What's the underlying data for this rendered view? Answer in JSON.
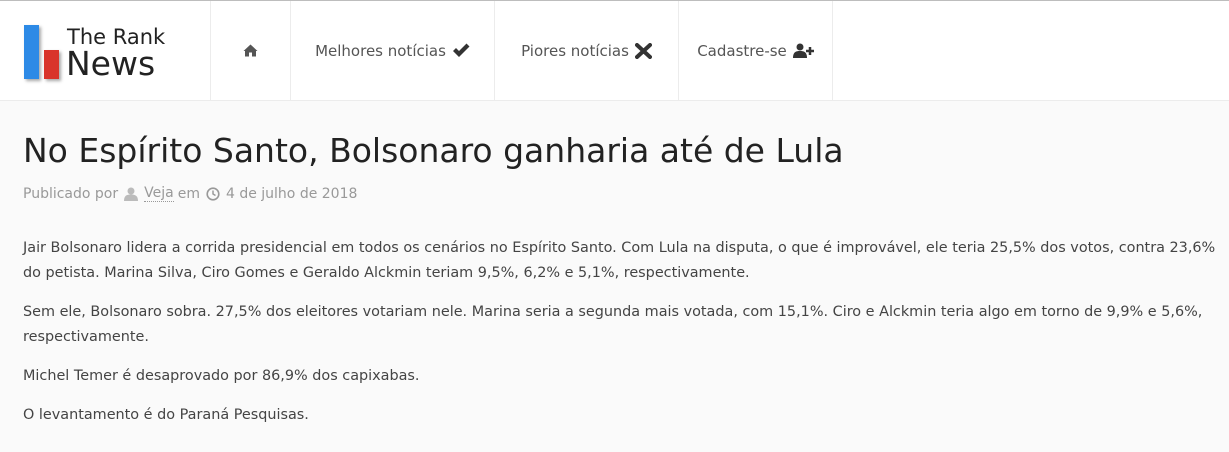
{
  "brand": {
    "line1": "The Rank",
    "line2": "News",
    "blue": "#2d8ae6",
    "red": "#d9342b"
  },
  "nav": {
    "home_icon": "home-icon",
    "best_label": "Melhores notícias",
    "best_icon": "check-icon",
    "worst_label": "Piores notícias",
    "worst_icon": "x-icon",
    "signup_label": "Cadastre-se",
    "signup_icon": "user-plus-icon"
  },
  "article": {
    "title": "No Espírito Santo, Bolsonaro ganharia até de Lula",
    "meta": {
      "published_by": "Publicado por",
      "author": "Veja",
      "in": "em",
      "date": "4 de julho de 2018"
    },
    "paragraphs": [
      "Jair Bolsonaro lidera a corrida presidencial em todos os cenários no Espírito Santo. Com Lula na disputa, o que é improvável, ele teria 25,5% dos votos, contra 23,6% do petista. Marina Silva, Ciro Gomes e Geraldo Alckmin teriam 9,5%, 6,2% e 5,1%, respectivamente.",
      "Sem ele, Bolsonaro sobra. 27,5% dos eleitores votariam nele. Marina seria a segunda mais votada, com 15,1%. Ciro e Alckmin teria algo em torno de 9,9% e 5,6%, respectivamente.",
      "Michel Temer é desaprovado por 86,9% dos capixabas.",
      "O levantamento é do Paraná Pesquisas."
    ]
  }
}
